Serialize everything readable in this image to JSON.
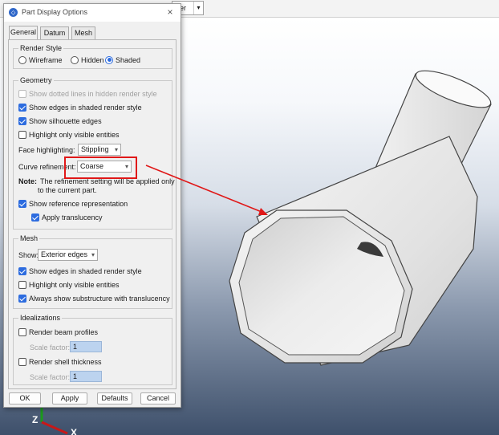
{
  "top_toolbar": {
    "combo_value": "der",
    "combo_arrow": "chevron-down-icon"
  },
  "dialog": {
    "title": "Part Display Options",
    "title_icon": "gear-icon",
    "close_symbol": "×",
    "tabs": [
      "General",
      "Datum",
      "Mesh"
    ],
    "render_style": {
      "group_title": "Render Style",
      "options": [
        "Wireframe",
        "Hidden",
        "Shaded"
      ],
      "selected": "Shaded"
    },
    "geometry": {
      "group_title": "Geometry",
      "dotted_lines": "Show dotted lines in hidden render style",
      "edges_shaded": "Show edges in shaded render style",
      "silhouette": "Show silhouette edges",
      "highlight_visible": "Highlight only visible entities",
      "face_hl_label": "Face highlighting:",
      "face_hl_value": "Stippling",
      "curve_label": "Curve refinement:",
      "curve_value": "Coarse",
      "note_label": "Note:",
      "note_line1": "The refinement setting will be applied only",
      "note_line2": "to the current part.",
      "show_ref": "Show reference representation",
      "apply_trans": "Apply translucency"
    },
    "mesh": {
      "group_title": "Mesh",
      "show_label": "Show:",
      "show_value": "Exterior edges",
      "edges_shaded": "Show edges in shaded render style",
      "highlight_visible": "Highlight only visible entities",
      "substructure": "Always show substructure with translucency"
    },
    "idealizations": {
      "group_title": "Idealizations",
      "beam": "Render beam profiles",
      "beam_scale_label": "Scale factor:",
      "beam_scale_value": "1",
      "shell": "Render shell thickness",
      "shell_scale_label": "Scale factor:",
      "shell_scale_value": "1"
    },
    "buttons": {
      "ok": "OK",
      "apply": "Apply",
      "defaults": "Defaults",
      "cancel": "Cancel"
    }
  },
  "triad": {
    "z_label": "Z",
    "x_label": "X"
  },
  "colors": {
    "highlight_red": "#e01818",
    "accent_blue": "#2d6cdf",
    "viewport_bottom": "#3e506b"
  }
}
